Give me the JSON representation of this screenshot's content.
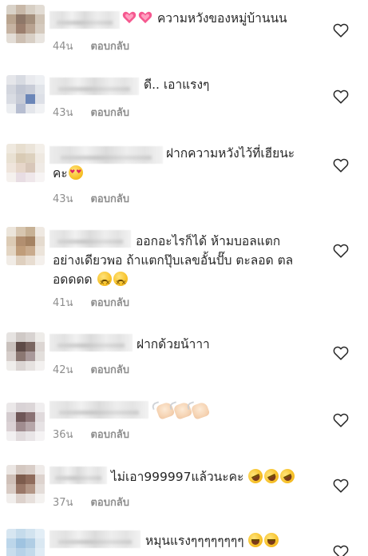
{
  "comments": [
    {
      "id": 1,
      "text": "ความหวังของหมู่บ้านนน",
      "emojis_before": [
        "growing-heart",
        "growing-heart"
      ],
      "time": "44น",
      "reply_label": "ตอบกลับ"
    },
    {
      "id": 2,
      "text": "ดี.. เอาแรงๆ",
      "time": "43น",
      "reply_label": "ตอบกลับ"
    },
    {
      "id": 3,
      "text_line1": "ฝากความหวังไว้ที่เฮียนะ",
      "text_line2": "คะ",
      "emojis_after": [
        "heart-eyes"
      ],
      "time": "43น",
      "reply_label": "ตอบกลับ"
    },
    {
      "id": 4,
      "text_line1": "ออกอะไรก็ได้ ห้ามบอลแตก",
      "text_line2": "อย่างเดียวพอ ถ้าแตกปุ๊บเลขอั้นปั๊บ ตะลอด ตล",
      "text_line3": "อดดดด",
      "emojis_after": [
        "persevering-face",
        "persevering-face"
      ],
      "time": "41น",
      "reply_label": "ตอบกลับ"
    },
    {
      "id": 5,
      "text": "ฝากด้วยน้าาา",
      "time": "42น",
      "reply_label": "ตอบกลับ"
    },
    {
      "id": 6,
      "emojis_only": [
        "clapping-hands",
        "clapping-hands",
        "clapping-hands"
      ],
      "time": "36น",
      "reply_label": "ตอบกลับ"
    },
    {
      "id": 7,
      "text": "ไม่เอา999997แล้วนะคะ",
      "emojis_after": [
        "rolling-laughing",
        "rolling-laughing",
        "rolling-laughing"
      ],
      "time": "37น",
      "reply_label": "ตอบกลับ"
    },
    {
      "id": 8,
      "text": "หมุนแรงๆๆๆๆๆๆๆๆ",
      "emojis_after": [
        "tears-of-joy",
        "tears-of-joy"
      ]
    }
  ],
  "colors": {
    "text": "#262626",
    "meta": "#8e8e8e",
    "heart_outline": "#262626",
    "emoji_heart": "#f5588f"
  },
  "icons": {
    "like": "heart-outline-icon"
  }
}
